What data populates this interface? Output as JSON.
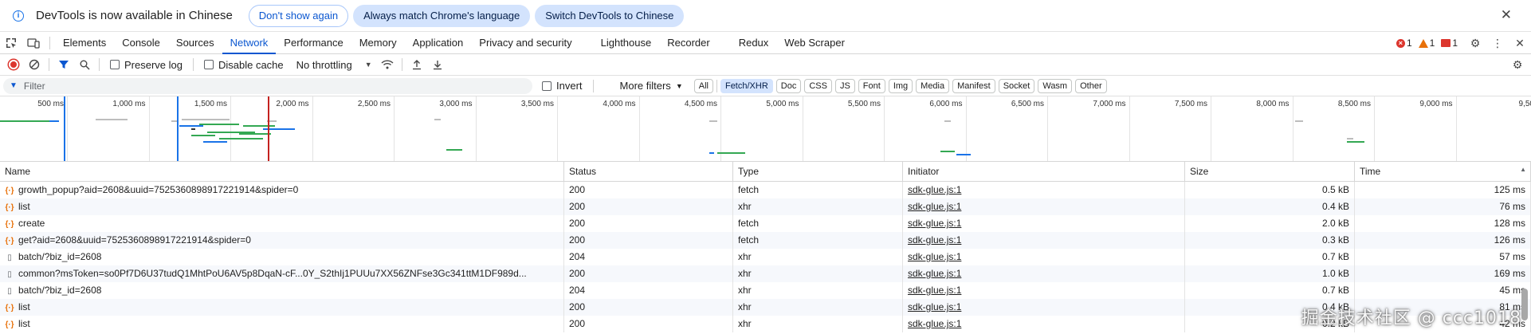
{
  "infobar": {
    "message": "DevTools is now available in Chinese",
    "dont_show": "Don't show again",
    "match_language": "Always match Chrome's language",
    "switch_chinese": "Switch DevTools to Chinese"
  },
  "tabs": [
    "Elements",
    "Console",
    "Sources",
    "Network",
    "Performance",
    "Memory",
    "Application",
    "Privacy and security",
    "Lighthouse",
    "Recorder",
    "Redux",
    "Web Scraper"
  ],
  "active_tab": "Network",
  "issues": {
    "errors": "1",
    "warnings": "1",
    "messages": "1"
  },
  "toolbar": {
    "preserve_log": "Preserve log",
    "disable_cache": "Disable cache",
    "throttling": "No throttling"
  },
  "filter": {
    "placeholder": "Filter",
    "invert": "Invert",
    "more_filters": "More filters",
    "chips": [
      "All",
      "Fetch/XHR",
      "Doc",
      "CSS",
      "JS",
      "Font",
      "Img",
      "Media",
      "Manifest",
      "Socket",
      "Wasm",
      "Other"
    ],
    "active_chip": "Fetch/XHR"
  },
  "overview": {
    "ticks": [
      "500 ms",
      "1,000 ms",
      "1,500 ms",
      "2,000 ms",
      "2,500 ms",
      "3,000 ms",
      "3,500 ms",
      "4,000 ms",
      "4,500 ms",
      "5,000 ms",
      "5,500 ms",
      "6,000 ms",
      "6,500 ms",
      "7,000 ms",
      "7,500 ms",
      "8,000 ms",
      "8,500 ms",
      "9,000 ms",
      "9,50"
    ]
  },
  "table": {
    "columns": [
      "Name",
      "Status",
      "Type",
      "Initiator",
      "Size",
      "Time"
    ],
    "rows": [
      {
        "icon": "fetch",
        "name": "growth_popup?aid=2608&uuid=7525360898917221914&spider=0",
        "status": "200",
        "type": "fetch",
        "initiator": "sdk-glue.js:1",
        "size": "0.5 kB",
        "time": "125 ms"
      },
      {
        "icon": "fetch",
        "name": "list",
        "status": "200",
        "type": "xhr",
        "initiator": "sdk-glue.js:1",
        "size": "0.4 kB",
        "time": "76 ms"
      },
      {
        "icon": "fetch",
        "name": "create",
        "status": "200",
        "type": "fetch",
        "initiator": "sdk-glue.js:1",
        "size": "2.0 kB",
        "time": "128 ms"
      },
      {
        "icon": "fetch",
        "name": "get?aid=2608&uuid=7525360898917221914&spider=0",
        "status": "200",
        "type": "fetch",
        "initiator": "sdk-glue.js:1",
        "size": "0.3 kB",
        "time": "126 ms"
      },
      {
        "icon": "doc",
        "name": "batch/?biz_id=2608",
        "status": "204",
        "type": "xhr",
        "initiator": "sdk-glue.js:1",
        "size": "0.7 kB",
        "time": "57 ms"
      },
      {
        "icon": "doc",
        "name": "common?msToken=so0Pf7D6U37tudQ1MhtPoU6AV5p8DqaN-cF...0Y_S2thIj1PUUu7XX56ZNFse3Gc341ttM1DF989d...",
        "status": "200",
        "type": "xhr",
        "initiator": "sdk-glue.js:1",
        "size": "1.0 kB",
        "time": "169 ms"
      },
      {
        "icon": "doc",
        "name": "batch/?biz_id=2608",
        "status": "204",
        "type": "xhr",
        "initiator": "sdk-glue.js:1",
        "size": "0.7 kB",
        "time": "45 ms"
      },
      {
        "icon": "fetch",
        "name": "list",
        "status": "200",
        "type": "xhr",
        "initiator": "sdk-glue.js:1",
        "size": "0.4 kB",
        "time": "81 ms"
      },
      {
        "icon": "fetch",
        "name": "list",
        "status": "200",
        "type": "xhr",
        "initiator": "sdk-glue.js:1",
        "size": "0.2 kB",
        "time": "42 ms"
      }
    ]
  },
  "watermark": "掘金技术社区 @ ccc1018"
}
